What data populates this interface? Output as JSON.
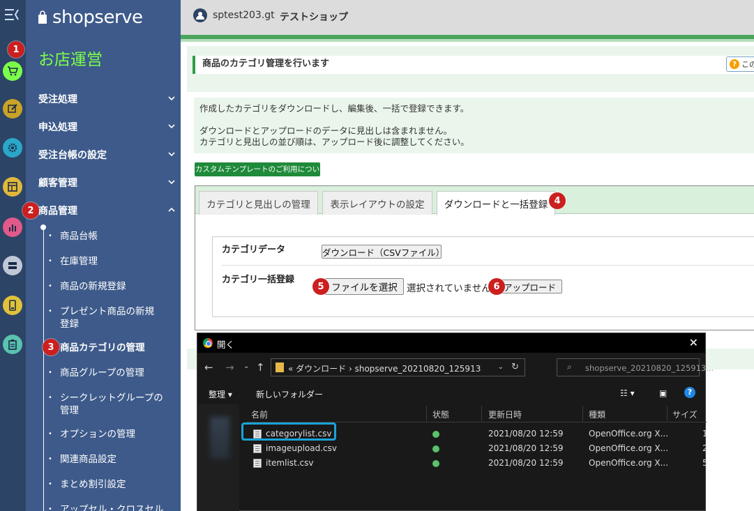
{
  "sidebar": {
    "logo": "shopserve",
    "section_title": "お店運営",
    "nav": [
      {
        "label": "受注処理"
      },
      {
        "label": "申込処理"
      },
      {
        "label": "受注台帳の設定"
      },
      {
        "label": "顧客管理"
      },
      {
        "label": "商品管理"
      }
    ],
    "sub": [
      {
        "label": "商品台帳"
      },
      {
        "label": "在庫管理"
      },
      {
        "label": "商品の新規登録"
      },
      {
        "label": "プレゼント商品の新規登録"
      },
      {
        "label": "商品カテゴリの管理"
      },
      {
        "label": "商品グループの管理"
      },
      {
        "label": "シークレットグループの管理"
      },
      {
        "label": "オプションの管理"
      },
      {
        "label": "関連商品設定"
      },
      {
        "label": "まとめ割引設定"
      },
      {
        "label": "アップセル・クロスセル"
      }
    ]
  },
  "rail": {
    "icons": [
      "cart-icon",
      "edit-icon",
      "gear-icon",
      "layout-icon",
      "chart-icon",
      "server-icon",
      "phone-icon",
      "clipboard-icon"
    ],
    "active_color": "#7cff4a"
  },
  "header": {
    "user": "sptest203.gt",
    "shop": "テストショップ"
  },
  "page": {
    "heading": "商品のカテゴリ管理を行います",
    "help_label": "この",
    "desc1": "作成したカテゴリをダウンロードし、編集後、一括で登録できます。",
    "desc2": "ダウンロードとアップロードのデータに見出しは含まれません。",
    "desc3": "カテゴリと見出しの並び順は、アップロード後に調整してください。",
    "template_link": "カスタムテンプレートのご利用について",
    "tabs": [
      {
        "label": "カテゴリと見出しの管理"
      },
      {
        "label": "表示レイアウトの設定"
      },
      {
        "label": "ダウンロードと一括登録"
      }
    ],
    "form": {
      "data_label": "カテゴリデータ",
      "download_btn": "ダウンロード（CSVファイル）",
      "bulk_label": "カテゴリ一括登録",
      "choose_btn": "ファイルを選択",
      "no_file": "選択されていません",
      "upload_btn": "アップロード"
    }
  },
  "badges": [
    "1",
    "2",
    "3",
    "4",
    "5",
    "6"
  ],
  "dialog": {
    "title": "開く",
    "path": "«  ダウンロード  ›  shopserve_20210820_125913",
    "search_placeholder": "shopserve_20210820_125913...",
    "organize": "整理 ▾",
    "new_folder": "新しいフォルダー",
    "columns": {
      "name": "名前",
      "status": "状態",
      "date": "更新日時",
      "type": "種類",
      "size": "サイズ"
    },
    "files": [
      {
        "name": "categorylist.csv",
        "date": "2021/08/20 12:59",
        "type": "OpenOffice.org X...",
        "size": "1"
      },
      {
        "name": "imageupload.csv",
        "date": "2021/08/20 12:59",
        "type": "OpenOffice.org X...",
        "size": "2"
      },
      {
        "name": "itemlist.csv",
        "date": "2021/08/20 12:59",
        "type": "OpenOffice.org X...",
        "size": "5"
      }
    ]
  }
}
